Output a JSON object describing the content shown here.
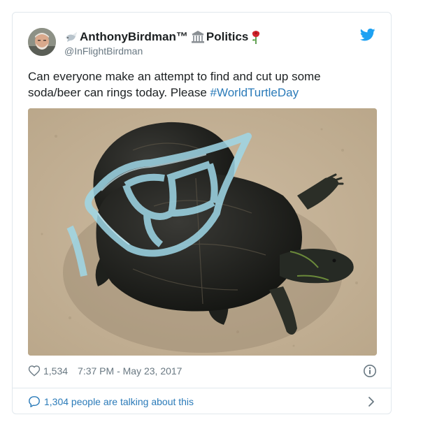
{
  "tweet": {
    "display_name": "AnthonyBirdman™",
    "category": "Politics",
    "handle": "@InFlightBirdman",
    "text": "Can everyone make an attempt to find and cut up some soda/beer can rings today. Please ",
    "hashtag": "#WorldTurtleDay",
    "likes": "1,534",
    "timestamp": "7:37 PM - May 23, 2017",
    "talking": "1,304 people are talking about this"
  },
  "icons": {
    "brand": "twitter-bird-icon",
    "heart": "heart-icon",
    "info": "info-icon",
    "reply": "speech-bubble-icon",
    "chevron": "chevron-right-icon",
    "emoji": [
      "dove-emoji",
      "classical-building-emoji",
      "rose-emoji"
    ]
  },
  "colors": {
    "link": "#2b7bb9",
    "muted": "#697882",
    "text": "#1c2022",
    "border": "#e1e8ed",
    "brand": "#1da1f2"
  }
}
